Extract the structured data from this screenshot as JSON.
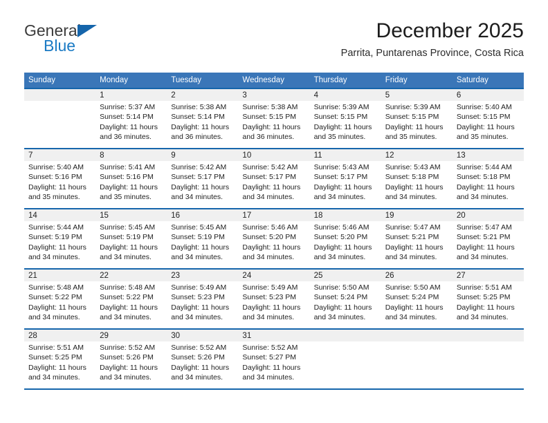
{
  "brand": {
    "name_part1": "General",
    "name_part2": "Blue",
    "triangle_color": "#1565ab",
    "blue_color": "#1a7ac4"
  },
  "header": {
    "month_title": "December 2025",
    "location": "Parrita, Puntarenas Province, Costa Rica"
  },
  "theme": {
    "header_bg": "#3a76b8",
    "header_text": "#ffffff",
    "week_separator": "#1565ab",
    "daynum_bg": "#f0f0f0",
    "cell_bg": "#ffffff"
  },
  "calendar": {
    "weekday_headers": [
      "Sunday",
      "Monday",
      "Tuesday",
      "Wednesday",
      "Thursday",
      "Friday",
      "Saturday"
    ],
    "weeks": [
      {
        "days": [
          {
            "number": "",
            "sunrise": "",
            "sunset": "",
            "daylight": "",
            "empty": true
          },
          {
            "number": "1",
            "sunrise": "Sunrise: 5:37 AM",
            "sunset": "Sunset: 5:14 PM",
            "daylight": "Daylight: 11 hours and 36 minutes."
          },
          {
            "number": "2",
            "sunrise": "Sunrise: 5:38 AM",
            "sunset": "Sunset: 5:14 PM",
            "daylight": "Daylight: 11 hours and 36 minutes."
          },
          {
            "number": "3",
            "sunrise": "Sunrise: 5:38 AM",
            "sunset": "Sunset: 5:15 PM",
            "daylight": "Daylight: 11 hours and 36 minutes."
          },
          {
            "number": "4",
            "sunrise": "Sunrise: 5:39 AM",
            "sunset": "Sunset: 5:15 PM",
            "daylight": "Daylight: 11 hours and 35 minutes."
          },
          {
            "number": "5",
            "sunrise": "Sunrise: 5:39 AM",
            "sunset": "Sunset: 5:15 PM",
            "daylight": "Daylight: 11 hours and 35 minutes."
          },
          {
            "number": "6",
            "sunrise": "Sunrise: 5:40 AM",
            "sunset": "Sunset: 5:15 PM",
            "daylight": "Daylight: 11 hours and 35 minutes."
          }
        ]
      },
      {
        "days": [
          {
            "number": "7",
            "sunrise": "Sunrise: 5:40 AM",
            "sunset": "Sunset: 5:16 PM",
            "daylight": "Daylight: 11 hours and 35 minutes."
          },
          {
            "number": "8",
            "sunrise": "Sunrise: 5:41 AM",
            "sunset": "Sunset: 5:16 PM",
            "daylight": "Daylight: 11 hours and 35 minutes."
          },
          {
            "number": "9",
            "sunrise": "Sunrise: 5:42 AM",
            "sunset": "Sunset: 5:17 PM",
            "daylight": "Daylight: 11 hours and 34 minutes."
          },
          {
            "number": "10",
            "sunrise": "Sunrise: 5:42 AM",
            "sunset": "Sunset: 5:17 PM",
            "daylight": "Daylight: 11 hours and 34 minutes."
          },
          {
            "number": "11",
            "sunrise": "Sunrise: 5:43 AM",
            "sunset": "Sunset: 5:17 PM",
            "daylight": "Daylight: 11 hours and 34 minutes."
          },
          {
            "number": "12",
            "sunrise": "Sunrise: 5:43 AM",
            "sunset": "Sunset: 5:18 PM",
            "daylight": "Daylight: 11 hours and 34 minutes."
          },
          {
            "number": "13",
            "sunrise": "Sunrise: 5:44 AM",
            "sunset": "Sunset: 5:18 PM",
            "daylight": "Daylight: 11 hours and 34 minutes."
          }
        ]
      },
      {
        "days": [
          {
            "number": "14",
            "sunrise": "Sunrise: 5:44 AM",
            "sunset": "Sunset: 5:19 PM",
            "daylight": "Daylight: 11 hours and 34 minutes."
          },
          {
            "number": "15",
            "sunrise": "Sunrise: 5:45 AM",
            "sunset": "Sunset: 5:19 PM",
            "daylight": "Daylight: 11 hours and 34 minutes."
          },
          {
            "number": "16",
            "sunrise": "Sunrise: 5:45 AM",
            "sunset": "Sunset: 5:19 PM",
            "daylight": "Daylight: 11 hours and 34 minutes."
          },
          {
            "number": "17",
            "sunrise": "Sunrise: 5:46 AM",
            "sunset": "Sunset: 5:20 PM",
            "daylight": "Daylight: 11 hours and 34 minutes."
          },
          {
            "number": "18",
            "sunrise": "Sunrise: 5:46 AM",
            "sunset": "Sunset: 5:20 PM",
            "daylight": "Daylight: 11 hours and 34 minutes."
          },
          {
            "number": "19",
            "sunrise": "Sunrise: 5:47 AM",
            "sunset": "Sunset: 5:21 PM",
            "daylight": "Daylight: 11 hours and 34 minutes."
          },
          {
            "number": "20",
            "sunrise": "Sunrise: 5:47 AM",
            "sunset": "Sunset: 5:21 PM",
            "daylight": "Daylight: 11 hours and 34 minutes."
          }
        ]
      },
      {
        "days": [
          {
            "number": "21",
            "sunrise": "Sunrise: 5:48 AM",
            "sunset": "Sunset: 5:22 PM",
            "daylight": "Daylight: 11 hours and 34 minutes."
          },
          {
            "number": "22",
            "sunrise": "Sunrise: 5:48 AM",
            "sunset": "Sunset: 5:22 PM",
            "daylight": "Daylight: 11 hours and 34 minutes."
          },
          {
            "number": "23",
            "sunrise": "Sunrise: 5:49 AM",
            "sunset": "Sunset: 5:23 PM",
            "daylight": "Daylight: 11 hours and 34 minutes."
          },
          {
            "number": "24",
            "sunrise": "Sunrise: 5:49 AM",
            "sunset": "Sunset: 5:23 PM",
            "daylight": "Daylight: 11 hours and 34 minutes."
          },
          {
            "number": "25",
            "sunrise": "Sunrise: 5:50 AM",
            "sunset": "Sunset: 5:24 PM",
            "daylight": "Daylight: 11 hours and 34 minutes."
          },
          {
            "number": "26",
            "sunrise": "Sunrise: 5:50 AM",
            "sunset": "Sunset: 5:24 PM",
            "daylight": "Daylight: 11 hours and 34 minutes."
          },
          {
            "number": "27",
            "sunrise": "Sunrise: 5:51 AM",
            "sunset": "Sunset: 5:25 PM",
            "daylight": "Daylight: 11 hours and 34 minutes."
          }
        ]
      },
      {
        "days": [
          {
            "number": "28",
            "sunrise": "Sunrise: 5:51 AM",
            "sunset": "Sunset: 5:25 PM",
            "daylight": "Daylight: 11 hours and 34 minutes."
          },
          {
            "number": "29",
            "sunrise": "Sunrise: 5:52 AM",
            "sunset": "Sunset: 5:26 PM",
            "daylight": "Daylight: 11 hours and 34 minutes."
          },
          {
            "number": "30",
            "sunrise": "Sunrise: 5:52 AM",
            "sunset": "Sunset: 5:26 PM",
            "daylight": "Daylight: 11 hours and 34 minutes."
          },
          {
            "number": "31",
            "sunrise": "Sunrise: 5:52 AM",
            "sunset": "Sunset: 5:27 PM",
            "daylight": "Daylight: 11 hours and 34 minutes."
          },
          {
            "number": "",
            "sunrise": "",
            "sunset": "",
            "daylight": "",
            "empty": true
          },
          {
            "number": "",
            "sunrise": "",
            "sunset": "",
            "daylight": "",
            "empty": true
          },
          {
            "number": "",
            "sunrise": "",
            "sunset": "",
            "daylight": "",
            "empty": true
          }
        ]
      }
    ]
  }
}
